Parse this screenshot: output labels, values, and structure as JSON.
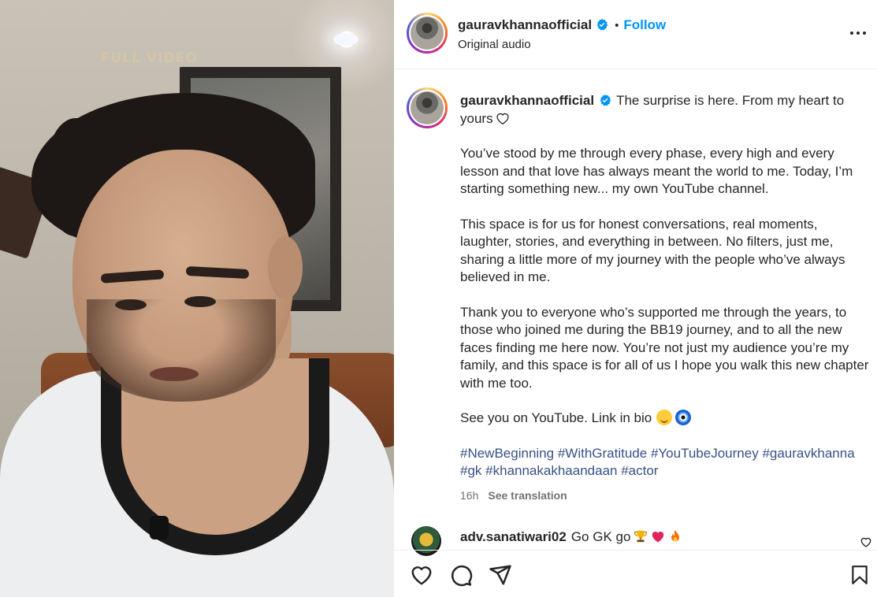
{
  "media": {
    "watermark": "FULL VIDEO"
  },
  "header": {
    "username": "gauravkhannaofficial",
    "separator": "•",
    "follow_label": "Follow",
    "subtitle": "Original audio",
    "more_icon": "more-horizontal-icon"
  },
  "caption": {
    "username": "gauravkhannaofficial",
    "intro": "The surprise is here. From my heart to yours",
    "paragraphs": [
      "You’ve stood by me through every phase, every high and every lesson and that love has always meant the world to me. Today, I’m starting something new... my own YouTube channel.",
      "This space is for us for honest conversations, real moments, laughter, stories, and everything in between. No filters, just me, sharing a little more of my journey with the people who’ve always believed in me.",
      "Thank you to everyone who’s supported me through the years, to those who joined me during the BB19 journey, and to all the new faces finding me here now. You’re not just my audience you’re my family, and this space is for all of us I hope you walk this new chapter with me too."
    ],
    "closing": "See you on YouTube. Link in bio",
    "hashtags": [
      "#NewBeginning",
      "#WithGratitude",
      "#YouTubeJourney",
      "#gauravkhanna",
      "#gk",
      "#khannakakhaandaan",
      "#actor"
    ],
    "time": "16h",
    "translate_label": "See translation"
  },
  "comment": {
    "username": "adv.sanatiwari02",
    "text": "Go GK go"
  },
  "colors": {
    "accent": "#0095f6",
    "verified": "#0095f6",
    "hashtag": "#385185",
    "muted": "#737373"
  }
}
